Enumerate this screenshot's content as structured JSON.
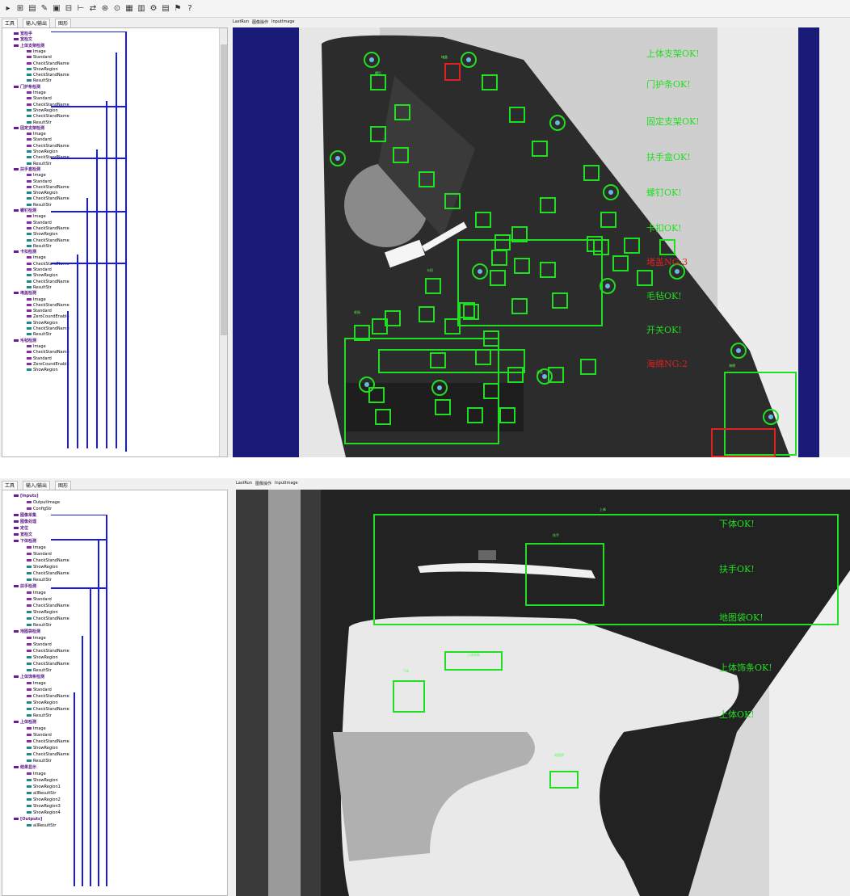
{
  "top": {
    "toolbar": [
      "▸",
      "⊞",
      "▤",
      "✎",
      "▣",
      "⊟",
      "⊢",
      "⇄",
      "⊛",
      "⊙",
      "▦",
      "▥",
      "⚙",
      "▤",
      "⚑",
      "?"
    ],
    "tabs": [
      "工具",
      "输入/输出",
      "图形"
    ],
    "image_tabs": [
      "LastRun",
      "图像操作",
      "InputImage"
    ],
    "tree": [
      {
        "t": "宽检手",
        "c": "mod"
      },
      {
        "t": "宽检文",
        "c": "mod"
      },
      {
        "t": "上体支架检测",
        "c": "mod"
      },
      {
        "t": "Image",
        "c": "purple"
      },
      {
        "t": "Standard",
        "c": "purple"
      },
      {
        "t": "CheckStandName",
        "c": "purple"
      },
      {
        "t": "ShowRegion",
        "c": "teal"
      },
      {
        "t": "CheckStandName",
        "c": "teal"
      },
      {
        "t": "ResultStr",
        "c": "teal"
      },
      {
        "t": "门护条检测",
        "c": "mod"
      },
      {
        "t": "Image",
        "c": "purple"
      },
      {
        "t": "Standard",
        "c": "purple"
      },
      {
        "t": "CheckStandName",
        "c": "purple"
      },
      {
        "t": "ShowRegion",
        "c": "teal"
      },
      {
        "t": "CheckStandName",
        "c": "teal"
      },
      {
        "t": "ResultStr",
        "c": "teal"
      },
      {
        "t": "固定支架检测",
        "c": "mod"
      },
      {
        "t": "Image",
        "c": "purple"
      },
      {
        "t": "Standard",
        "c": "purple"
      },
      {
        "t": "CheckStandName",
        "c": "purple"
      },
      {
        "t": "ShowRegion",
        "c": "teal"
      },
      {
        "t": "CheckStandName",
        "c": "teal"
      },
      {
        "t": "ResultStr",
        "c": "teal"
      },
      {
        "t": "扶手盒检测",
        "c": "mod"
      },
      {
        "t": "Image",
        "c": "purple"
      },
      {
        "t": "Standard",
        "c": "purple"
      },
      {
        "t": "CheckStandName",
        "c": "purple"
      },
      {
        "t": "ShowRegion",
        "c": "teal"
      },
      {
        "t": "CheckStandName",
        "c": "teal"
      },
      {
        "t": "ResultStr",
        "c": "teal"
      },
      {
        "t": "螺钉检测",
        "c": "mod"
      },
      {
        "t": "Image",
        "c": "purple"
      },
      {
        "t": "Standard",
        "c": "purple"
      },
      {
        "t": "CheckStandName",
        "c": "purple"
      },
      {
        "t": "ShowRegion",
        "c": "teal"
      },
      {
        "t": "CheckStandName",
        "c": "teal"
      },
      {
        "t": "ResultStr",
        "c": "teal"
      },
      {
        "t": "卡扣检测",
        "c": "mod"
      },
      {
        "t": "Image",
        "c": "purple"
      },
      {
        "t": "CheckStandName",
        "c": "purple"
      },
      {
        "t": "Standard",
        "c": "purple"
      },
      {
        "t": "ShowRegion",
        "c": "teal"
      },
      {
        "t": "CheckStandName",
        "c": "teal"
      },
      {
        "t": "ResultStr",
        "c": "teal"
      },
      {
        "t": "堵盖检测",
        "c": "mod"
      },
      {
        "t": "Image",
        "c": "purple"
      },
      {
        "t": "CheckStandName",
        "c": "purple"
      },
      {
        "t": "Standard",
        "c": "purple"
      },
      {
        "t": "ZeroCoundEnable",
        "c": "purple"
      },
      {
        "t": "ShowRegion",
        "c": "teal"
      },
      {
        "t": "CheckStandName",
        "c": "teal"
      },
      {
        "t": "ResultStr",
        "c": "teal"
      },
      {
        "t": "毛毡检测",
        "c": "mod"
      },
      {
        "t": "Image",
        "c": "purple"
      },
      {
        "t": "CheckStandName",
        "c": "purple"
      },
      {
        "t": "Standard",
        "c": "purple"
      },
      {
        "t": "ZeroCoundEnable",
        "c": "purple"
      },
      {
        "t": "ShowRegion",
        "c": "teal"
      }
    ],
    "statuses": [
      {
        "t": "上体支架OK!",
        "c": "#22dd22"
      },
      {
        "t": "门护条OK!",
        "c": "#22dd22"
      },
      {
        "t": "固定支架OK!",
        "c": "#22dd22"
      },
      {
        "t": "扶手盒OK!",
        "c": "#22dd22"
      },
      {
        "t": "螺钉OK!",
        "c": "#22dd22"
      },
      {
        "t": "卡扣OK!",
        "c": "#22dd22"
      },
      {
        "t": "堵盖NG:3",
        "c": "#dd2222"
      },
      {
        "t": "毛毡OK!",
        "c": "#22dd22"
      },
      {
        "t": "开关OK!",
        "c": "#22dd22"
      },
      {
        "t": "海绵NG:2",
        "c": "#dd2222"
      }
    ],
    "labels": [
      "堵盖",
      "螺钉",
      "卡扣",
      "毛毡",
      "开关",
      "海绵"
    ]
  },
  "bottom": {
    "tabs": [
      "工具",
      "输入/输出",
      "图形"
    ],
    "image_tabs": [
      "LastRun",
      "图像操作",
      "InputImage"
    ],
    "tree": [
      {
        "t": "[Inputs]",
        "c": "mod"
      },
      {
        "t": "OutputImage",
        "c": "purple"
      },
      {
        "t": "ConfigStr",
        "c": "purple"
      },
      {
        "t": "图像采集",
        "c": "mod"
      },
      {
        "t": "图像处理",
        "c": "mod"
      },
      {
        "t": "定位",
        "c": "mod"
      },
      {
        "t": "宽检文",
        "c": "mod"
      },
      {
        "t": "下体检测",
        "c": "mod"
      },
      {
        "t": "Image",
        "c": "purple"
      },
      {
        "t": "Standard",
        "c": "purple"
      },
      {
        "t": "CheckStandName",
        "c": "purple"
      },
      {
        "t": "ShowRegion",
        "c": "teal"
      },
      {
        "t": "CheckStandName",
        "c": "teal"
      },
      {
        "t": "ResultStr",
        "c": "teal"
      },
      {
        "t": "扶手检测",
        "c": "mod"
      },
      {
        "t": "Image",
        "c": "purple"
      },
      {
        "t": "Standard",
        "c": "purple"
      },
      {
        "t": "CheckStandName",
        "c": "purple"
      },
      {
        "t": "ShowRegion",
        "c": "teal"
      },
      {
        "t": "CheckStandName",
        "c": "teal"
      },
      {
        "t": "ResultStr",
        "c": "teal"
      },
      {
        "t": "地图袋检测",
        "c": "mod"
      },
      {
        "t": "Image",
        "c": "purple"
      },
      {
        "t": "Standard",
        "c": "purple"
      },
      {
        "t": "CheckStandName",
        "c": "purple"
      },
      {
        "t": "ShowRegion",
        "c": "teal"
      },
      {
        "t": "CheckStandName",
        "c": "teal"
      },
      {
        "t": "ResultStr",
        "c": "teal"
      },
      {
        "t": "上体饰条检测",
        "c": "mod"
      },
      {
        "t": "Image",
        "c": "purple"
      },
      {
        "t": "Standard",
        "c": "purple"
      },
      {
        "t": "CheckStandName",
        "c": "purple"
      },
      {
        "t": "ShowRegion",
        "c": "teal"
      },
      {
        "t": "CheckStandName",
        "c": "teal"
      },
      {
        "t": "ResultStr",
        "c": "teal"
      },
      {
        "t": "上体检测",
        "c": "mod"
      },
      {
        "t": "Image",
        "c": "purple"
      },
      {
        "t": "Standard",
        "c": "purple"
      },
      {
        "t": "CheckStandName",
        "c": "purple"
      },
      {
        "t": "ShowRegion",
        "c": "teal"
      },
      {
        "t": "CheckStandName",
        "c": "teal"
      },
      {
        "t": "ResultStr",
        "c": "teal"
      },
      {
        "t": "结果显示",
        "c": "mod"
      },
      {
        "t": "Image",
        "c": "purple"
      },
      {
        "t": "ShowRegion",
        "c": "teal"
      },
      {
        "t": "ShowRegion1",
        "c": "teal"
      },
      {
        "t": "allResultStr",
        "c": "teal"
      },
      {
        "t": "ShowRegion2",
        "c": "teal"
      },
      {
        "t": "ShowRegion3",
        "c": "teal"
      },
      {
        "t": "ShowRegion4",
        "c": "teal"
      },
      {
        "t": "[Outputs]",
        "c": "mod"
      },
      {
        "t": "allResultStr",
        "c": "teal"
      }
    ],
    "statuses": [
      "下体OK!",
      "扶手OK!",
      "地图袋OK!",
      "上体饰条OK!",
      "上体OK!"
    ],
    "labels": [
      "上体饰条",
      "扶手",
      "下体",
      "地图袋",
      "上体"
    ]
  }
}
